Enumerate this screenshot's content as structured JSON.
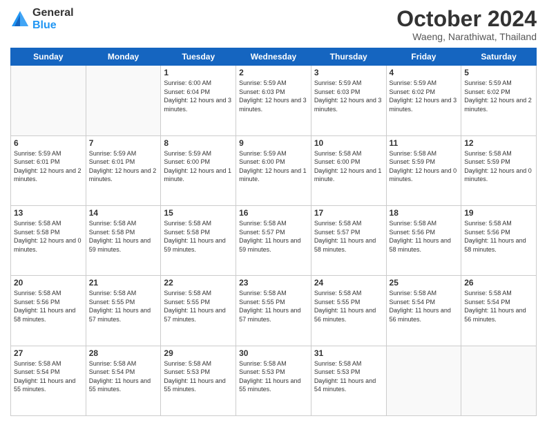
{
  "logo": {
    "general": "General",
    "blue": "Blue"
  },
  "title": "October 2024",
  "subtitle": "Waeng, Narathiwat, Thailand",
  "days": [
    "Sunday",
    "Monday",
    "Tuesday",
    "Wednesday",
    "Thursday",
    "Friday",
    "Saturday"
  ],
  "weeks": [
    [
      {
        "day": "",
        "info": ""
      },
      {
        "day": "",
        "info": ""
      },
      {
        "day": "1",
        "info": "Sunrise: 6:00 AM\nSunset: 6:04 PM\nDaylight: 12 hours\nand 3 minutes."
      },
      {
        "day": "2",
        "info": "Sunrise: 5:59 AM\nSunset: 6:03 PM\nDaylight: 12 hours\nand 3 minutes."
      },
      {
        "day": "3",
        "info": "Sunrise: 5:59 AM\nSunset: 6:03 PM\nDaylight: 12 hours\nand 3 minutes."
      },
      {
        "day": "4",
        "info": "Sunrise: 5:59 AM\nSunset: 6:02 PM\nDaylight: 12 hours\nand 3 minutes."
      },
      {
        "day": "5",
        "info": "Sunrise: 5:59 AM\nSunset: 6:02 PM\nDaylight: 12 hours\nand 2 minutes."
      }
    ],
    [
      {
        "day": "6",
        "info": "Sunrise: 5:59 AM\nSunset: 6:01 PM\nDaylight: 12 hours\nand 2 minutes."
      },
      {
        "day": "7",
        "info": "Sunrise: 5:59 AM\nSunset: 6:01 PM\nDaylight: 12 hours\nand 2 minutes."
      },
      {
        "day": "8",
        "info": "Sunrise: 5:59 AM\nSunset: 6:00 PM\nDaylight: 12 hours\nand 1 minute."
      },
      {
        "day": "9",
        "info": "Sunrise: 5:59 AM\nSunset: 6:00 PM\nDaylight: 12 hours\nand 1 minute."
      },
      {
        "day": "10",
        "info": "Sunrise: 5:58 AM\nSunset: 6:00 PM\nDaylight: 12 hours\nand 1 minute."
      },
      {
        "day": "11",
        "info": "Sunrise: 5:58 AM\nSunset: 5:59 PM\nDaylight: 12 hours\nand 0 minutes."
      },
      {
        "day": "12",
        "info": "Sunrise: 5:58 AM\nSunset: 5:59 PM\nDaylight: 12 hours\nand 0 minutes."
      }
    ],
    [
      {
        "day": "13",
        "info": "Sunrise: 5:58 AM\nSunset: 5:58 PM\nDaylight: 12 hours\nand 0 minutes."
      },
      {
        "day": "14",
        "info": "Sunrise: 5:58 AM\nSunset: 5:58 PM\nDaylight: 11 hours\nand 59 minutes."
      },
      {
        "day": "15",
        "info": "Sunrise: 5:58 AM\nSunset: 5:58 PM\nDaylight: 11 hours\nand 59 minutes."
      },
      {
        "day": "16",
        "info": "Sunrise: 5:58 AM\nSunset: 5:57 PM\nDaylight: 11 hours\nand 59 minutes."
      },
      {
        "day": "17",
        "info": "Sunrise: 5:58 AM\nSunset: 5:57 PM\nDaylight: 11 hours\nand 58 minutes."
      },
      {
        "day": "18",
        "info": "Sunrise: 5:58 AM\nSunset: 5:56 PM\nDaylight: 11 hours\nand 58 minutes."
      },
      {
        "day": "19",
        "info": "Sunrise: 5:58 AM\nSunset: 5:56 PM\nDaylight: 11 hours\nand 58 minutes."
      }
    ],
    [
      {
        "day": "20",
        "info": "Sunrise: 5:58 AM\nSunset: 5:56 PM\nDaylight: 11 hours\nand 58 minutes."
      },
      {
        "day": "21",
        "info": "Sunrise: 5:58 AM\nSunset: 5:55 PM\nDaylight: 11 hours\nand 57 minutes."
      },
      {
        "day": "22",
        "info": "Sunrise: 5:58 AM\nSunset: 5:55 PM\nDaylight: 11 hours\nand 57 minutes."
      },
      {
        "day": "23",
        "info": "Sunrise: 5:58 AM\nSunset: 5:55 PM\nDaylight: 11 hours\nand 57 minutes."
      },
      {
        "day": "24",
        "info": "Sunrise: 5:58 AM\nSunset: 5:55 PM\nDaylight: 11 hours\nand 56 minutes."
      },
      {
        "day": "25",
        "info": "Sunrise: 5:58 AM\nSunset: 5:54 PM\nDaylight: 11 hours\nand 56 minutes."
      },
      {
        "day": "26",
        "info": "Sunrise: 5:58 AM\nSunset: 5:54 PM\nDaylight: 11 hours\nand 56 minutes."
      }
    ],
    [
      {
        "day": "27",
        "info": "Sunrise: 5:58 AM\nSunset: 5:54 PM\nDaylight: 11 hours\nand 55 minutes."
      },
      {
        "day": "28",
        "info": "Sunrise: 5:58 AM\nSunset: 5:54 PM\nDaylight: 11 hours\nand 55 minutes."
      },
      {
        "day": "29",
        "info": "Sunrise: 5:58 AM\nSunset: 5:53 PM\nDaylight: 11 hours\nand 55 minutes."
      },
      {
        "day": "30",
        "info": "Sunrise: 5:58 AM\nSunset: 5:53 PM\nDaylight: 11 hours\nand 55 minutes."
      },
      {
        "day": "31",
        "info": "Sunrise: 5:58 AM\nSunset: 5:53 PM\nDaylight: 11 hours\nand 54 minutes."
      },
      {
        "day": "",
        "info": ""
      },
      {
        "day": "",
        "info": ""
      }
    ]
  ]
}
